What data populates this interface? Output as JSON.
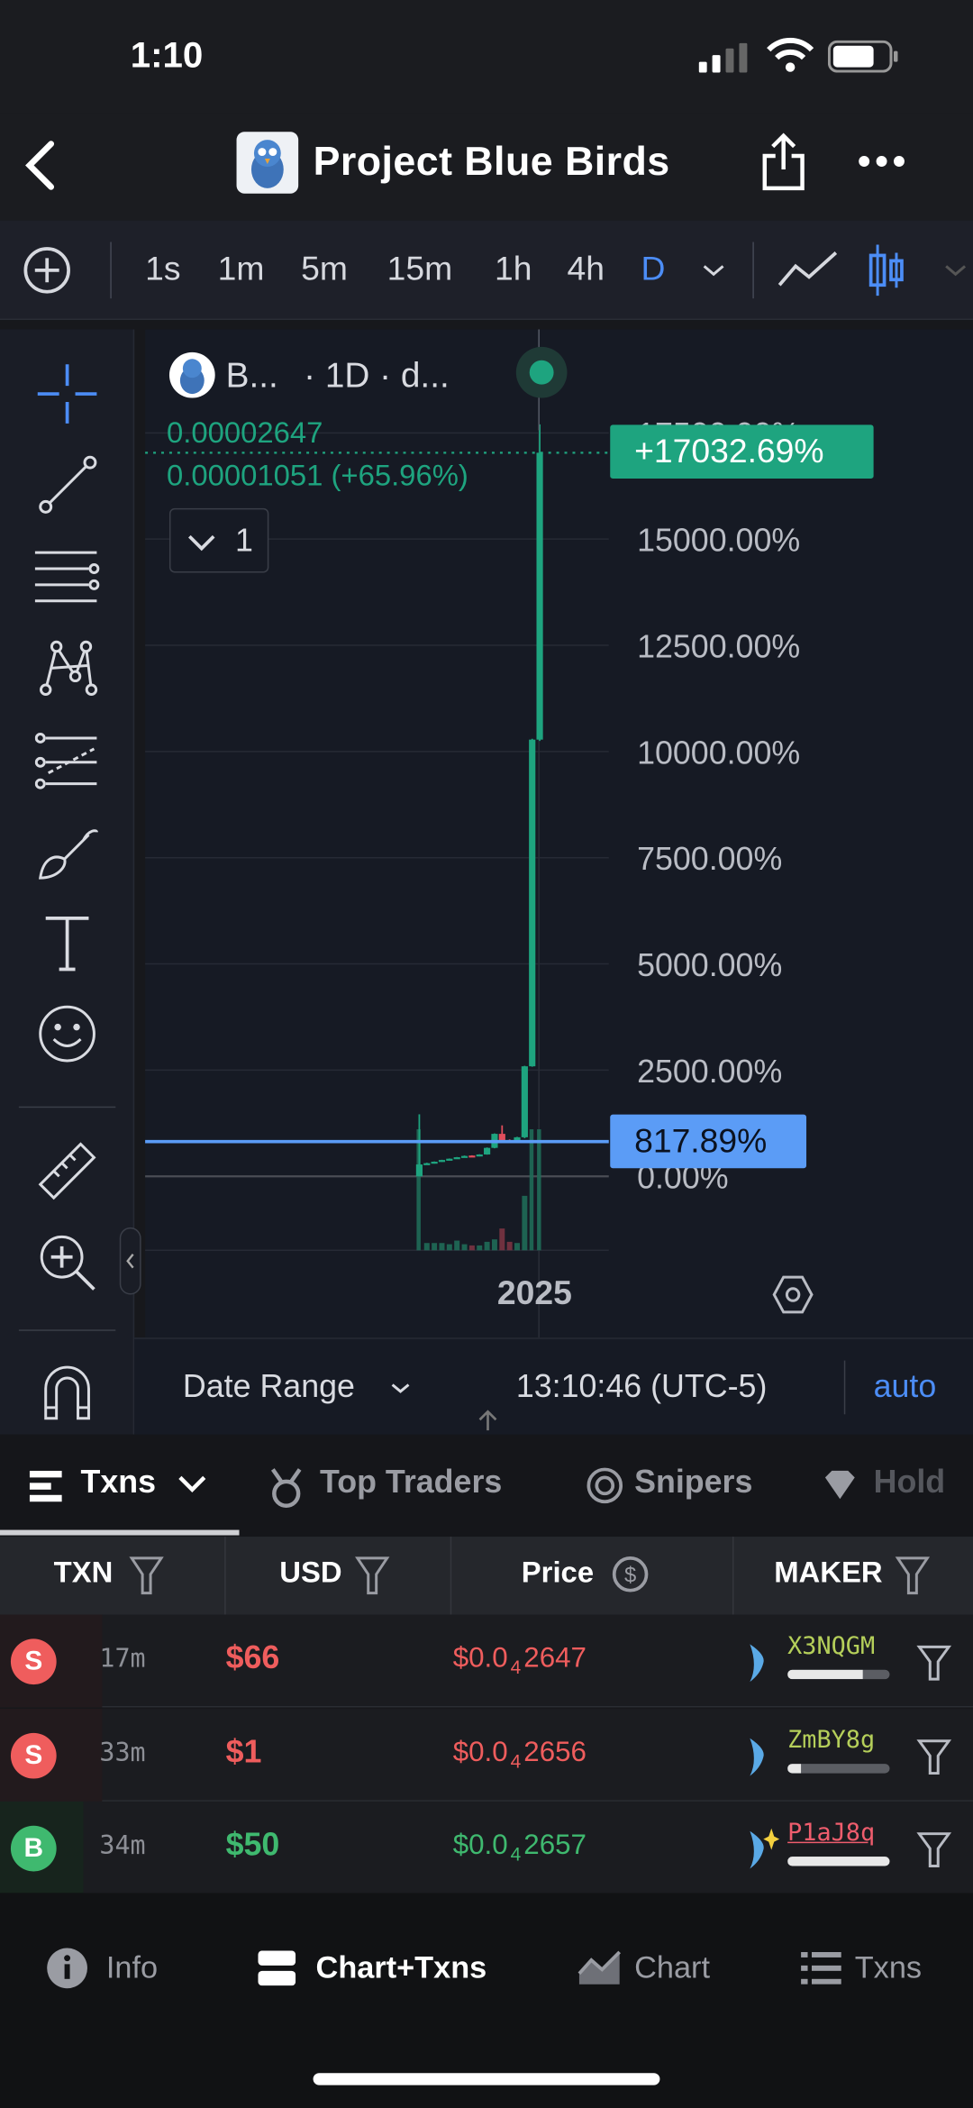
{
  "status_bar": {
    "time": "1:10"
  },
  "header": {
    "title": "Project Blue Birds"
  },
  "toolbar": {
    "intervals": [
      "1s",
      "1m",
      "5m",
      "15m",
      "1h",
      "4h",
      "D"
    ],
    "active_interval": "D",
    "accent": "#4c8df6"
  },
  "chart_legend": {
    "symbol": "B...",
    "interval": "· 1D · d...",
    "price": "0.00002647",
    "change": "0.00001051 (+65.96%)",
    "indicator_count": "1"
  },
  "chart_data": {
    "type": "candlestick",
    "ylim": [
      -1800,
      17800
    ],
    "y_ticks": [
      "17500.00%",
      "15000.00%",
      "12500.00%",
      "10000.00%",
      "7500.00%",
      "5000.00%",
      "2500.00%",
      "0.00%"
    ],
    "x_ticks": [
      "2025"
    ],
    "last_value_label": "+17032.69%",
    "crosshair_label": "817.89%",
    "crosshair_value": 817.89,
    "up_color": "#1ea47f",
    "down_color": "#e14d5b",
    "crosshair_color": "#5b9cf6",
    "candles": [
      [
        0,
        1460,
        0,
        280
      ],
      [
        280,
        320,
        270,
        310
      ],
      [
        310,
        350,
        300,
        345
      ],
      [
        345,
        390,
        340,
        385
      ],
      [
        385,
        420,
        380,
        415
      ],
      [
        415,
        455,
        410,
        450
      ],
      [
        450,
        490,
        445,
        480
      ],
      [
        490,
        495,
        470,
        475
      ],
      [
        475,
        520,
        470,
        515
      ],
      [
        515,
        680,
        510,
        670
      ],
      [
        670,
        1010,
        660,
        1000
      ],
      [
        1000,
        1200,
        820,
        830
      ],
      [
        830,
        870,
        800,
        820
      ],
      [
        830,
        930,
        820,
        920
      ],
      [
        920,
        2600,
        900,
        2590
      ],
      [
        2590,
        10300,
        2580,
        10280
      ],
      [
        10280,
        17700,
        10250,
        17032.69
      ]
    ],
    "volumes": [
      100,
      6,
      6,
      6,
      5,
      8,
      5,
      4,
      4,
      7,
      9,
      18,
      7,
      6,
      45,
      100,
      100
    ]
  },
  "chart_footer": {
    "date_range": "Date Range",
    "clock": "13:10:46 (UTC-5)",
    "auto": "auto"
  },
  "tabs": {
    "items": [
      "Txns",
      "Top Traders",
      "Snipers",
      "Hold"
    ],
    "active": "Txns"
  },
  "table": {
    "columns": [
      "TXN",
      "USD",
      "Price",
      "MAKER"
    ],
    "rows": [
      {
        "type": "S",
        "age": "17m",
        "usd": "$66",
        "price_prefix": "$0.0",
        "price_zeros": "4",
        "price_digits": "2647",
        "maker": "X3NQGM",
        "maker_bar": 0.74,
        "maker_color": "#b5cf5a",
        "side_color": "#ef5d5d"
      },
      {
        "type": "S",
        "age": "33m",
        "usd": "$1",
        "price_prefix": "$0.0",
        "price_zeros": "4",
        "price_digits": "2656",
        "maker": "ZmBY8g",
        "maker_bar": 0.13,
        "maker_color": "#b5cf5a",
        "side_color": "#ef5d5d"
      },
      {
        "type": "B",
        "age": "34m",
        "usd": "$50",
        "price_prefix": "$0.0",
        "price_zeros": "4",
        "price_digits": "2657",
        "maker": "P1aJ8q",
        "maker_bar": 1.0,
        "maker_color": "#ef5d6d",
        "side_color": "#3fb96f"
      }
    ]
  },
  "bottom_nav": {
    "items": [
      "Info",
      "Chart+Txns",
      "Chart",
      "Txns"
    ],
    "active": "Chart+Txns"
  }
}
